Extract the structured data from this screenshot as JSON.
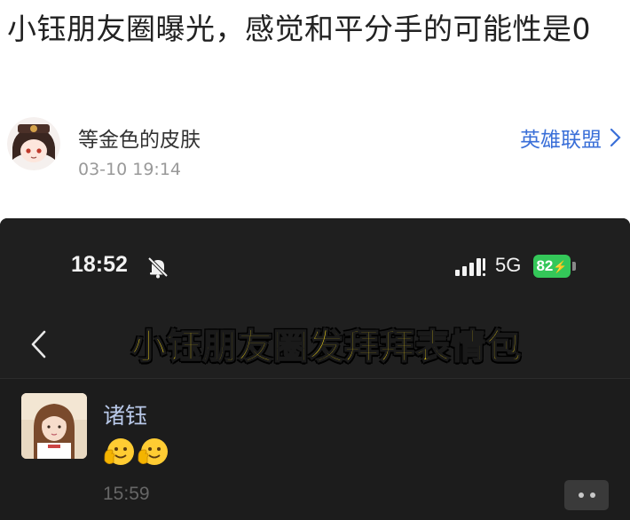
{
  "post": {
    "title": "小钰朋友圈曝光，感觉和平分手的可能性是0",
    "author": "等金色的皮肤",
    "time": "03-10 19:14",
    "channel": "英雄联盟"
  },
  "screenshot": {
    "status_bar": {
      "time": "18:52",
      "network": "5G",
      "battery": "82"
    },
    "caption": "小钰朋友圈发拜拜表情包",
    "moment": {
      "name": "诸钰",
      "time": "15:59"
    }
  },
  "icons": {
    "mute": "bell-slash-icon",
    "signal": "signal-bars-icon",
    "back": "chevron-left-icon",
    "channel_arrow": "chevron-right-icon",
    "emoji": "waving-hand-face-emoji",
    "more": "more-dots-icon"
  },
  "colors": {
    "link": "#3a6fd8",
    "caption": "#ffe01a",
    "battery": "#34c759",
    "moment_name": "#b8c8e8"
  }
}
